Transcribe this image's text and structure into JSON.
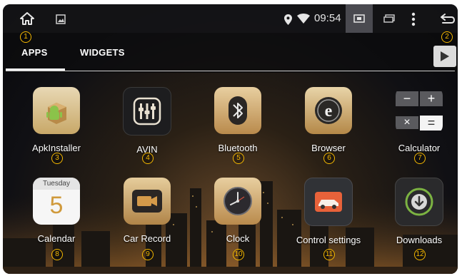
{
  "status_bar": {
    "time": "09:54",
    "icons": [
      "home-icon",
      "gallery-icon",
      "location-icon",
      "wifi-icon",
      "screenshot-icon",
      "recent-apps-icon",
      "menu-icon",
      "back-icon"
    ]
  },
  "tabs": [
    {
      "label": "APPS",
      "selected": true
    },
    {
      "label": "WIDGETS",
      "selected": false
    }
  ],
  "store_icon": "play-store-icon",
  "apps": [
    {
      "label": "ApkInstaller",
      "icon": "apk-installer-icon",
      "callout": "3"
    },
    {
      "label": "AVIN",
      "icon": "avin-icon",
      "callout": "4"
    },
    {
      "label": "Bluetooth",
      "icon": "bluetooth-icon",
      "callout": "5"
    },
    {
      "label": "Browser",
      "icon": "browser-icon",
      "callout": "6"
    },
    {
      "label": "Calculator",
      "icon": "calculator-icon",
      "callout": "7"
    },
    {
      "label": "Calendar",
      "icon": "calendar-icon",
      "callout": "8"
    },
    {
      "label": "Car Record",
      "icon": "car-record-icon",
      "callout": "9"
    },
    {
      "label": "Clock",
      "icon": "clock-icon",
      "callout": "10"
    },
    {
      "label": "Control settings",
      "icon": "control-settings-icon",
      "callout": "11"
    },
    {
      "label": "Downloads",
      "icon": "downloads-icon",
      "callout": "12"
    }
  ],
  "calendar_icon_text": {
    "weekday": "Tuesday",
    "day": "5"
  },
  "calculator_symbols": [
    "−",
    "+",
    "×",
    "="
  ],
  "callouts": {
    "home": "1",
    "back": "2"
  },
  "colors": {
    "callout": "#f5b800",
    "status_bar": "#141416",
    "tab_underline": "#f0f0f0"
  }
}
